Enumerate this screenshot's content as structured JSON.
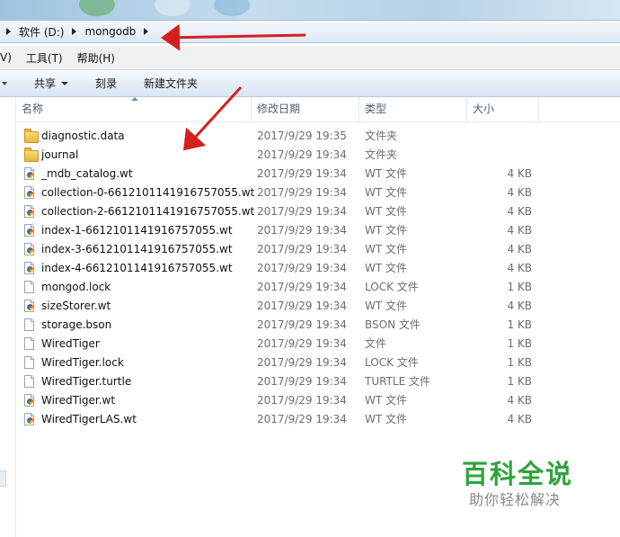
{
  "breadcrumb": {
    "drive": "软件 (D:)",
    "folder": "mongodb"
  },
  "menu": {
    "view_partial": "V)",
    "tools": "工具(T)",
    "help": "帮助(H)"
  },
  "toolbar": {
    "share": "共享",
    "burn": "刻录",
    "new_folder": "新建文件夹"
  },
  "columns": {
    "name": "名称",
    "date": "修改日期",
    "type": "类型",
    "size": "大小"
  },
  "files": [
    {
      "name": "diagnostic.data",
      "date": "2017/9/29 19:35",
      "type": "文件夹",
      "size": "",
      "icon": "folder-icon"
    },
    {
      "name": "journal",
      "date": "2017/9/29 19:34",
      "type": "文件夹",
      "size": "",
      "icon": "folder-icon"
    },
    {
      "name": "_mdb_catalog.wt",
      "date": "2017/9/29 19:34",
      "type": "WT 文件",
      "size": "4 KB",
      "icon": "wt-file-icon"
    },
    {
      "name": "collection-0-6612101141916757055.wt",
      "date": "2017/9/29 19:34",
      "type": "WT 文件",
      "size": "4 KB",
      "icon": "wt-file-icon"
    },
    {
      "name": "collection-2-6612101141916757055.wt",
      "date": "2017/9/29 19:34",
      "type": "WT 文件",
      "size": "4 KB",
      "icon": "wt-file-icon"
    },
    {
      "name": "index-1-6612101141916757055.wt",
      "date": "2017/9/29 19:34",
      "type": "WT 文件",
      "size": "4 KB",
      "icon": "wt-file-icon"
    },
    {
      "name": "index-3-6612101141916757055.wt",
      "date": "2017/9/29 19:34",
      "type": "WT 文件",
      "size": "4 KB",
      "icon": "wt-file-icon"
    },
    {
      "name": "index-4-6612101141916757055.wt",
      "date": "2017/9/29 19:34",
      "type": "WT 文件",
      "size": "4 KB",
      "icon": "wt-file-icon"
    },
    {
      "name": "mongod.lock",
      "date": "2017/9/29 19:34",
      "type": "LOCK 文件",
      "size": "1 KB",
      "icon": "file-icon"
    },
    {
      "name": "sizeStorer.wt",
      "date": "2017/9/29 19:34",
      "type": "WT 文件",
      "size": "4 KB",
      "icon": "wt-file-icon"
    },
    {
      "name": "storage.bson",
      "date": "2017/9/29 19:34",
      "type": "BSON 文件",
      "size": "1 KB",
      "icon": "file-icon"
    },
    {
      "name": "WiredTiger",
      "date": "2017/9/29 19:34",
      "type": "文件",
      "size": "1 KB",
      "icon": "file-icon"
    },
    {
      "name": "WiredTiger.lock",
      "date": "2017/9/29 19:34",
      "type": "LOCK 文件",
      "size": "1 KB",
      "icon": "file-icon"
    },
    {
      "name": "WiredTiger.turtle",
      "date": "2017/9/29 19:34",
      "type": "TURTLE 文件",
      "size": "1 KB",
      "icon": "file-icon"
    },
    {
      "name": "WiredTiger.wt",
      "date": "2017/9/29 19:34",
      "type": "WT 文件",
      "size": "4 KB",
      "icon": "wt-file-icon"
    },
    {
      "name": "WiredTigerLAS.wt",
      "date": "2017/9/29 19:34",
      "type": "WT 文件",
      "size": "4 KB",
      "icon": "wt-file-icon"
    }
  ],
  "watermark": {
    "title": "百科全说",
    "subtitle": "助你轻松解决"
  },
  "colors": {
    "annotation_arrow": "#d42020",
    "watermark_green": "#2ea43c"
  }
}
